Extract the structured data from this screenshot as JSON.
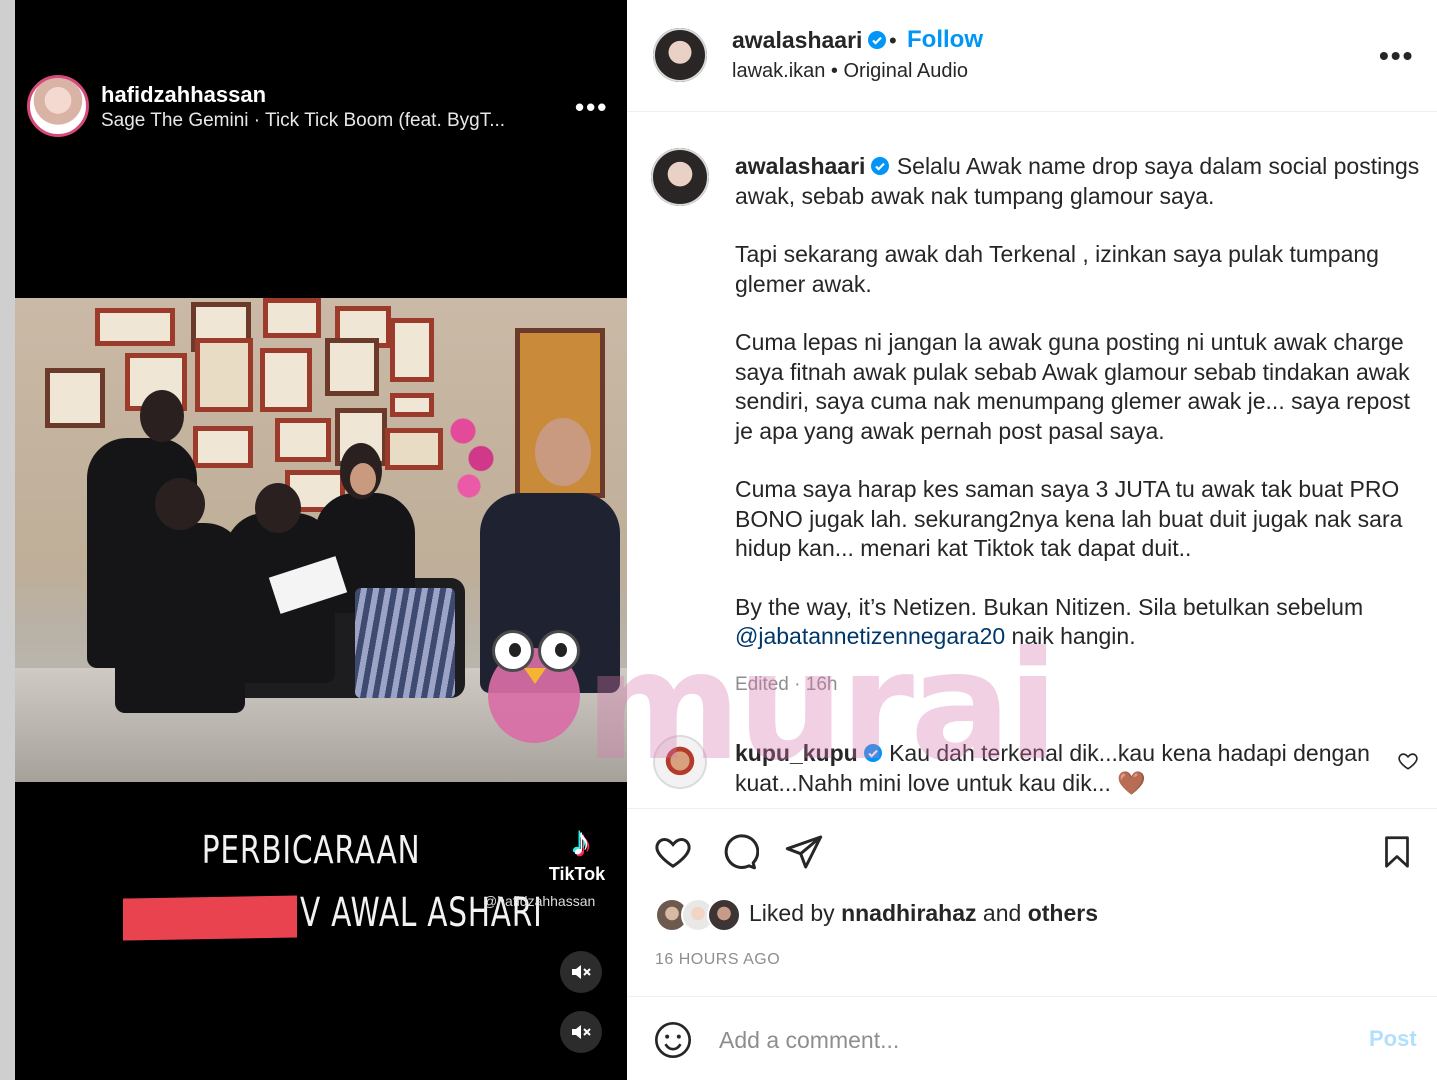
{
  "video": {
    "username": "hafidzahhassan",
    "track": "Sage The Gemini · Tick Tick Boom (feat. BygT...",
    "more": "•••",
    "caption_line1": "PERBICARAAN",
    "caption_line2": "V AWAL ASHARI",
    "tiktok_label": "TikTok",
    "tiktok_handle": "@hafidzahhassan",
    "redaction_color": "#e94350"
  },
  "post": {
    "header": {
      "username": "awalashaari",
      "separator": "•",
      "follow_label": "Follow",
      "audio": "lawak.ikan • Original Audio",
      "more": "•••"
    },
    "caption": {
      "username": "awalashaari",
      "p1": "Selalu Awak name drop saya dalam social postings awak, sebab awak nak tumpang glamour saya.",
      "p2": "Tapi sekarang awak dah Terkenal , izinkan saya pulak tumpang glemer awak.",
      "p3": "Cuma lepas ni jangan la awak guna posting ni untuk awak charge saya fitnah awak pulak sebab Awak glamour sebab tindakan awak sendiri, saya cuma nak menumpang glemer awak je... saya repost je apa yang awak pernah post pasal saya.",
      "p4": "Cuma saya harap kes saman saya 3 JUTA tu awak tak buat PRO BONO jugak lah. sekurang2nya kena lah buat duit jugak nak sara hidup kan... menari kat Tiktok tak dapat duit..",
      "p5_before": "By the way, it’s Netizen. Bukan Nitizen. Sila betulkan sebelum ",
      "p5_mention": "@jabatannetizennegara20",
      "p5_after": " naik hangin.",
      "meta": "Edited · 16h"
    },
    "comment": {
      "username": "kupu_kupu",
      "text": "Kau dah terkenal dik...kau kena hadapi dengan kuat...Nahh mini love untuk kau dik...",
      "emoji": "🤎"
    },
    "likes": {
      "prefix": "Liked by ",
      "user": "nnadhirahaz",
      "middle": " and ",
      "others": "others"
    },
    "time_ago": "16 HOURS AGO",
    "add_comment_placeholder": "Add a comment...",
    "post_label": "Post"
  },
  "watermark": "murai",
  "colors": {
    "accent": "#0095f6",
    "verified": "#0095f6",
    "mention": "#00376b",
    "muted": "#8e8e8e",
    "post_disabled": "#b2dffc"
  }
}
